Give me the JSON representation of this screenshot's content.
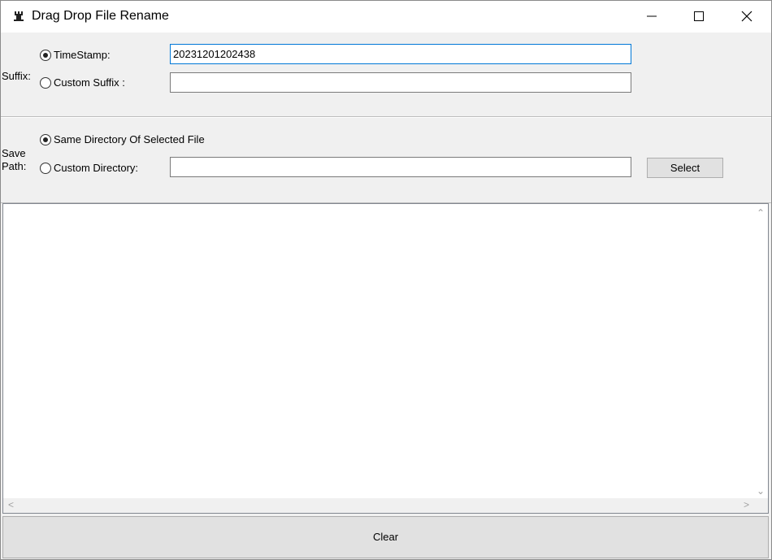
{
  "window": {
    "title": "Drag Drop File Rename",
    "icon": "app-icon",
    "controls": [
      "minimize-icon",
      "maximize-icon",
      "close-icon"
    ]
  },
  "suffix": {
    "label": "Suffix:",
    "timestamp_label": "TimeStamp:",
    "timestamp_value": "20231201202438",
    "timestamp_checked": true,
    "custom_label": "Custom Suffix :",
    "custom_value": "",
    "custom_checked": false
  },
  "save_path": {
    "label_line1": "Save",
    "label_line2": "Path:",
    "same_dir_label": "Same Directory Of Selected File",
    "same_dir_checked": true,
    "custom_label": "Custom Directory:",
    "custom_value": "",
    "custom_checked": false,
    "select_label": "Select"
  },
  "file_list": {
    "items": []
  },
  "clear_label": "Clear",
  "colors": {
    "focus_border": "#0078d7",
    "window_bg": "#f0f0f0",
    "button_bg": "#e1e1e1"
  }
}
